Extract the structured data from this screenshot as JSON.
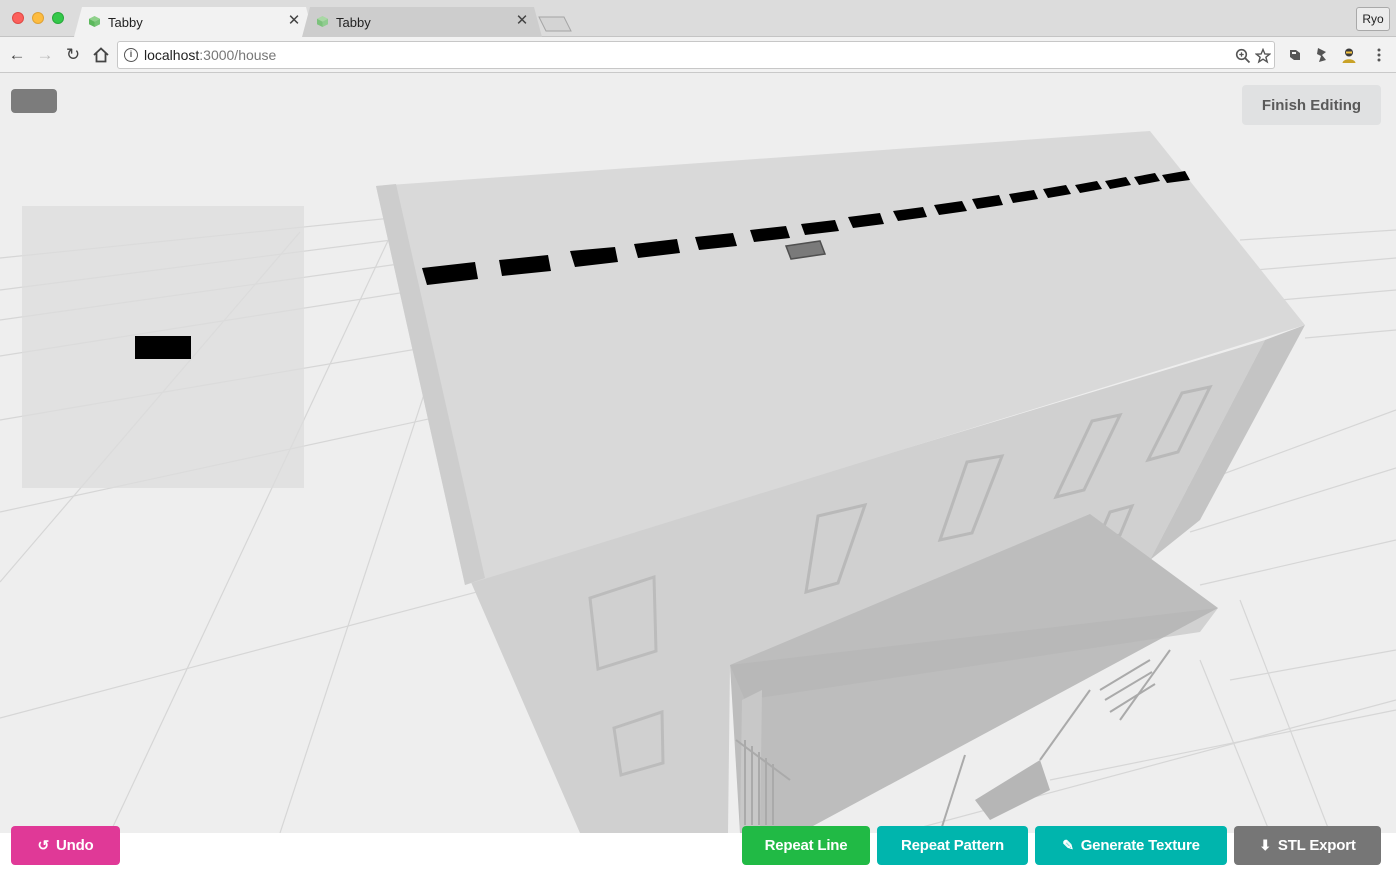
{
  "browser": {
    "tabs": [
      {
        "title": "Tabby",
        "active": true
      },
      {
        "title": "Tabby",
        "active": false
      }
    ],
    "close_glyph": "✕",
    "profile": "Ryo",
    "url_host": "localhost",
    "url_path": ":3000/house",
    "nav": {
      "back": "←",
      "forward": "→",
      "reload": "↻"
    }
  },
  "editor": {
    "finish_editing": "Finish Editing",
    "buttons": {
      "undo": "Undo",
      "undo_icon": "↺",
      "repeat_line": "Repeat Line",
      "repeat_pattern": "Repeat Pattern",
      "generate_texture": "Generate Texture",
      "generate_icon": "✎",
      "stl_export": "STL Export",
      "stl_icon": "⬇"
    }
  },
  "colors": {
    "undo": "#e03997",
    "repeat_line": "#21ba45",
    "teal": "#00b5ad",
    "stl": "#767676"
  }
}
